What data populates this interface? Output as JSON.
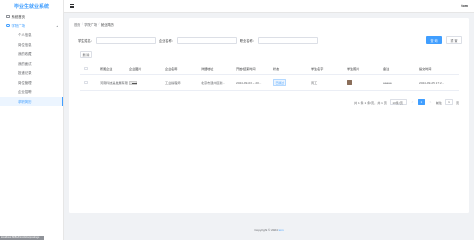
{
  "app": {
    "title": "毕业生就业系统",
    "user": "tom"
  },
  "sidebar": {
    "home": "系统首页",
    "group": "学院广场",
    "items": [
      {
        "label": "个人信息"
      },
      {
        "label": "岗位信息"
      },
      {
        "label": "我的收藏"
      },
      {
        "label": "我的面试"
      },
      {
        "label": "投递记录"
      },
      {
        "label": "岗位管理"
      },
      {
        "label": "企业招聘"
      },
      {
        "label": "求职简历"
      }
    ]
  },
  "breadcrumb": [
    "首页",
    "学院广场",
    "就业简历"
  ],
  "search": {
    "label1": "学生姓名：",
    "label2": "企业名称：",
    "label3": "职业名称：",
    "query_button": "查 询",
    "reset_button": "重 置"
  },
  "toolbar": {
    "delete_label": "删 除"
  },
  "table": {
    "columns": [
      "所属企业",
      "企业图片",
      "企业名称",
      "详细地址",
      "开始/结束时间",
      "状态",
      "学生名字",
      "学生照片",
      "备注",
      "提交时间"
    ],
    "rows": [
      {
        "company": "河南科技是发展有限",
        "name": "工业操程师",
        "address": "北京市通州区新...",
        "time": "2024-09-03 ~ 20...",
        "status": "已通过",
        "student": "周工",
        "note": "aaaaa",
        "submitted": "2024-09-25 17:2..."
      }
    ]
  },
  "pagination": {
    "summary": "共 1 条 1 条/页，共 1 页",
    "page_size": "10条/页",
    "prev": "<",
    "current": "1",
    "next": ">",
    "jump_prefix": "前往",
    "jump_value": "1",
    "jump_suffix": "页"
  },
  "footer": {
    "copyright_prefix": "Copyright © 2024 ",
    "copyright_link": "tom",
    "badge": "localhost:8081/FindJobs/postings"
  }
}
